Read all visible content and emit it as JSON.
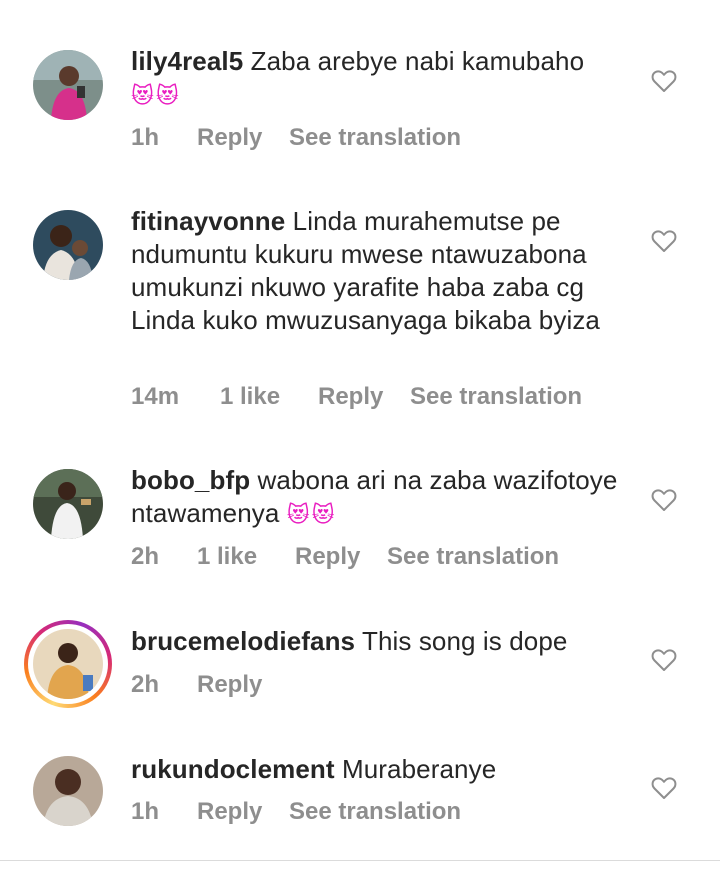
{
  "comments": [
    {
      "username": "lily4real5",
      "text": "Zaba arebye nabi kamubaho",
      "emoji": "😻😻",
      "time": "1h",
      "likes": "",
      "reply_label": "Reply",
      "translate_label": "See translation"
    },
    {
      "username": "fitinayvonne",
      "text": "Linda murahemutse pe ndumuntu kukuru mwese ntawuzabona umukunzi nkuwo yarafite haba zaba cg Linda kuko mwuzusanyaga bikaba byiza",
      "time": "14m",
      "likes": "1 like",
      "reply_label": "Reply",
      "translate_label": "See translation"
    },
    {
      "username": "bobo_bfp",
      "text": "wabona ari na zaba wazifotoye ntawamenya",
      "emoji": "😻😻",
      "time": "2h",
      "likes": "1 like",
      "reply_label": "Reply",
      "translate_label": "See translation"
    },
    {
      "username": "brucemelodiefans",
      "text": "This song is dope",
      "time": "2h",
      "reply_label": "Reply"
    },
    {
      "username": "rukundoclement",
      "text": "Muraberanye",
      "time": "1h",
      "reply_label": "Reply",
      "translate_label": "See translation"
    }
  ],
  "icons": {
    "like": "heart-outline-icon"
  },
  "colors": {
    "text": "#262626",
    "meta": "#8e8e8e",
    "story_ring": [
      "#feda75",
      "#fa7e1e",
      "#d62976",
      "#962fbf"
    ]
  }
}
